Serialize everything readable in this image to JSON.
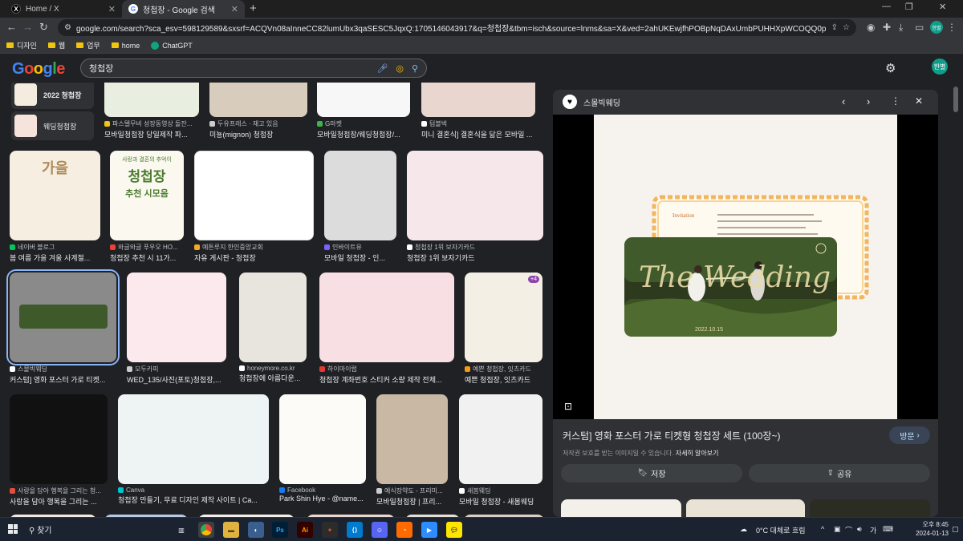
{
  "browser": {
    "tabs": [
      {
        "title": "Home / X"
      },
      {
        "title": "청첩장 - Google 검색"
      }
    ],
    "url": "google.com/search?sca_esv=598129589&sxsrf=ACQVn08aInneCC82lumUbx3qaSESC5JqxQ:1705146043917&q=청첩장&tbm=isch&source=lnms&sa=X&ved=2ahUKEwjfhPOBpNqDAxUmbPUHHXpWCOQQ0pQJegQIEBAB&biw=1920&bih...",
    "bookmarks": [
      "디자인",
      "웹",
      "업무",
      "home",
      "ChatGPT"
    ],
    "profile_label": "한별"
  },
  "google": {
    "search_value": "청첩장",
    "account_label": "한별"
  },
  "related": [
    {
      "label": "2022 청첩장"
    },
    {
      "label": "웨딩청첩장"
    }
  ],
  "results": [
    {
      "source": "파스텔무비 성장동영상 돌잔...",
      "title": "모바일청첩장 당일제작 파..."
    },
    {
      "source": "두유프레스 · 재고 있음",
      "title": "미뇽(mignon) 청첩장"
    },
    {
      "source": "G마켓",
      "title": "모바일청첩장/웨딩청첩장/..."
    },
    {
      "source": "텀블벅",
      "title": "미니 결혼식] 결혼식을 닮은 모바일 ..."
    },
    {
      "source": "네이버 블로그",
      "title": "봄 여름 가을 겨울 사계절..."
    },
    {
      "source": "와글와글 푸우오 HO...",
      "title": "청첩장 추천 시 11가..."
    },
    {
      "source": "예튼루지 한인중앙교회",
      "title": "자유 게시판 - 청첩장"
    },
    {
      "source": "인바이트유",
      "title": "모바일 청첩장 - 인..."
    },
    {
      "source": "청첩장 1위 보자기카드",
      "title": "청첩장 1위 보자기카드"
    },
    {
      "source": "스몰빅웨딩",
      "title": "커스텀] 영화 포스터 가로 티켓..."
    },
    {
      "source": "모두카피",
      "title": "WED_135/사진(포토)청첩장,..."
    },
    {
      "source": "honeymore.co.kr",
      "title": "청첩장에 아름다운..."
    },
    {
      "source": "하이마이럽",
      "title": "청첩장 계좌번호 스티커 소량 제작 전체..."
    },
    {
      "source": "예쁜 청첩장, 잇츠카드",
      "title": "예쁜 청첩장, 잇츠카드"
    },
    {
      "source": "사랑을 담아 행복을 그리는 청...",
      "title": "사랑을 담아 행복을 그리는 ..."
    },
    {
      "source": "Canva",
      "title": "청첩장 만들기, 무료 디자인 제작 사이트 | Ca..."
    },
    {
      "source": "Facebook",
      "title": "Park Shin Hye - @name..."
    },
    {
      "source": "예식장약도 - 프리미...",
      "title": "모바일청첩장 | 프리..."
    },
    {
      "source": "새봄웨딩",
      "title": "모바일 청첩장 - 새봄웨딩"
    }
  ],
  "image_text": {
    "r1_4": "가을",
    "r1_5a": "사랑과 결혼의 추억이",
    "r1_5b": "청첩장",
    "r1_5c": "추천 시모음",
    "badge": "+4"
  },
  "preview": {
    "site": "스몰빅웨딩",
    "title": "커스텀] 영화 포스터 가로 티켓형 청첩장 세트 (100장~)",
    "visit_label": "방문",
    "copyright_note": "저작권 보호를 받는 이미지일 수 있습니다.",
    "learn_more": "자세히 알아보기",
    "save_label": "저장",
    "share_label": "공유",
    "card_heading": "Invitation",
    "ticket_script": "The Wedding",
    "ticket_date": "2022.10.15"
  },
  "taskbar": {
    "search_label": "찾기",
    "weather": "0°C 대체로 흐림",
    "time": "오후 8:45",
    "date": "2024-01-13"
  },
  "colors": {
    "accent": "#8ab4f8",
    "page_bg": "#202124",
    "panel_bg": "#303134"
  }
}
